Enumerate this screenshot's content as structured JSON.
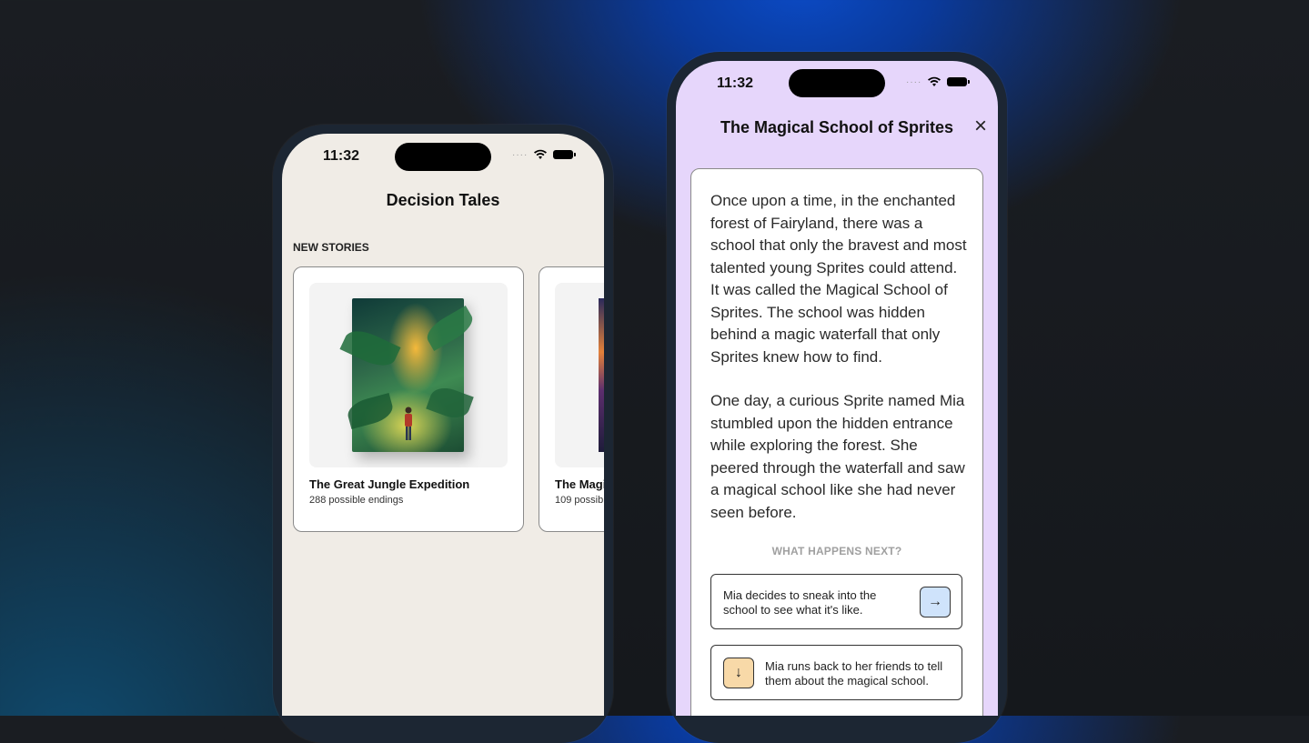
{
  "left_phone": {
    "status": {
      "time": "11:32"
    },
    "app_title": "Decision Tales",
    "section_label": "NEW STORIES",
    "stories": [
      {
        "title": "The Great Jungle Expedition",
        "endings": "288 possible endings"
      },
      {
        "title": "The Magi",
        "endings": "109 possib"
      }
    ]
  },
  "right_phone": {
    "status": {
      "time": "11:32"
    },
    "story_title": "The Magical School of Sprites",
    "close_icon": "×",
    "paragraphs": [
      "Once upon a time, in the enchanted forest of Fairyland, there was a school that only the bravest and most talented young Sprites could attend. It was called the Magical School of Sprites. The school was hidden behind a magic waterfall that only Sprites knew how to find.",
      "One day, a curious Sprite named Mia stumbled upon the hidden entrance while exploring the forest. She peered through the waterfall and saw a magical school like she had never seen before."
    ],
    "next_label": "WHAT HAPPENS NEXT?",
    "choices": [
      {
        "text": "Mia decides to sneak into the school to see what it's like.",
        "icon": "arrow-right-icon",
        "glyph": "→",
        "color": "#cfe3fb"
      },
      {
        "text": "Mia runs back to her friends to tell them about the magical school.",
        "icon": "arrow-down-icon",
        "glyph": "↓",
        "color": "#f8d9a8"
      }
    ]
  },
  "colors": {
    "left_bg": "#f0ece6",
    "right_bg": "#e6d6fb",
    "choice_primary": "#cfe3fb",
    "choice_secondary": "#f8d9a8"
  }
}
